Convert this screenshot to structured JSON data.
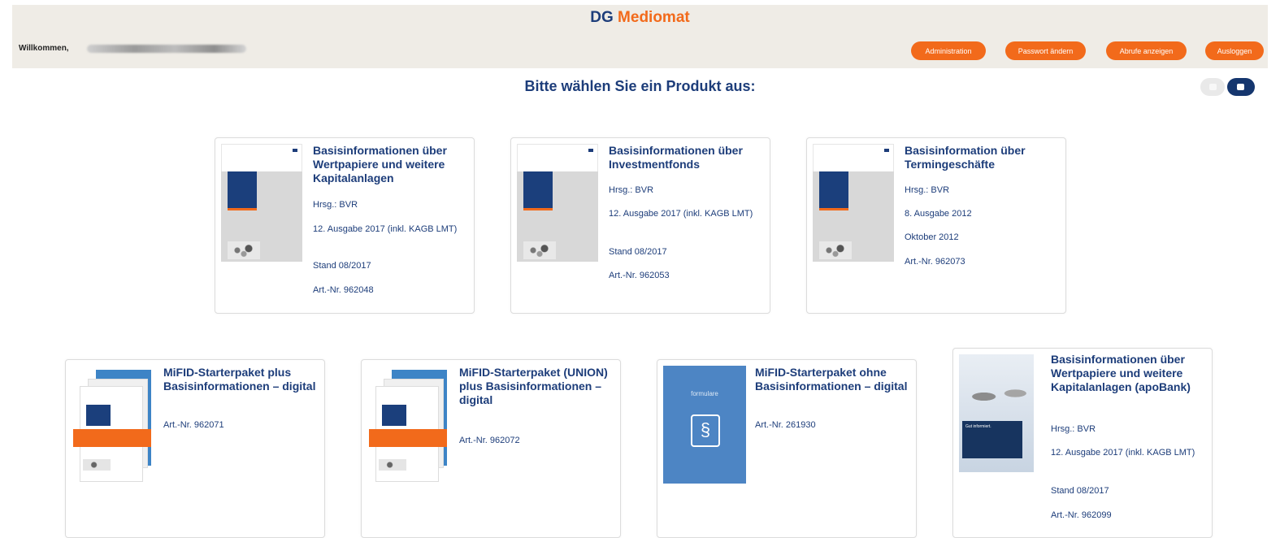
{
  "app": {
    "brand_dg": "DG",
    "brand_name": "Mediomat"
  },
  "header": {
    "welcome": "Willkommen,",
    "buttons": [
      "Administration",
      "Passwort ändern",
      "Abrufe anzeigen",
      "Ausloggen"
    ]
  },
  "page_title": "Bitte wählen Sie ein Produkt aus:",
  "colors": {
    "accent": "#f26a1b",
    "brand_blue": "#1d3d7a",
    "header_bg": "#efece6"
  },
  "products": [
    {
      "title": "Basisinformationen über Wertpapiere und weitere Kapitalanlagen",
      "lines": [
        "Hrsg.: BVR",
        "12. Ausgabe 2017 (inkl. KAGB LMT)",
        "Stand 08/2017",
        "Art.-Nr. 962048"
      ]
    },
    {
      "title": "Basisinformationen über Investmentfonds",
      "lines": [
        "Hrsg.: BVR",
        "12. Ausgabe 2017 (inkl. KAGB LMT)",
        "Stand 08/2017",
        "Art.-Nr. 962053"
      ]
    },
    {
      "title": "Basisinformation über Termingeschäfte",
      "lines": [
        "Hrsg.: BVR",
        "8. Ausgabe 2012",
        "Oktober 2012",
        "Art.-Nr. 962073"
      ]
    },
    {
      "title": "MiFID-Starterpaket plus Basisinformationen – digital",
      "lines": [
        "Art.-Nr. 962071"
      ]
    },
    {
      "title": "MiFID-Starterpaket (UNION) plus Basisinformationen – digital",
      "lines": [
        "Art.-Nr. 962072"
      ]
    },
    {
      "title": "MiFID-Starterpaket ohne Basisinformationen – digital",
      "lines": [
        "Art.-Nr. 261930"
      ],
      "cover_label": "formulare",
      "cover_symbol": "§"
    },
    {
      "title": "Basisinformationen über Wertpapiere und weitere Kapitalanlagen (apoBank)",
      "lines": [
        "Hrsg.: BVR",
        "12. Ausgabe 2017 (inkl. KAGB LMT)",
        "Stand 08/2017",
        "Art.-Nr. 962099"
      ]
    }
  ]
}
